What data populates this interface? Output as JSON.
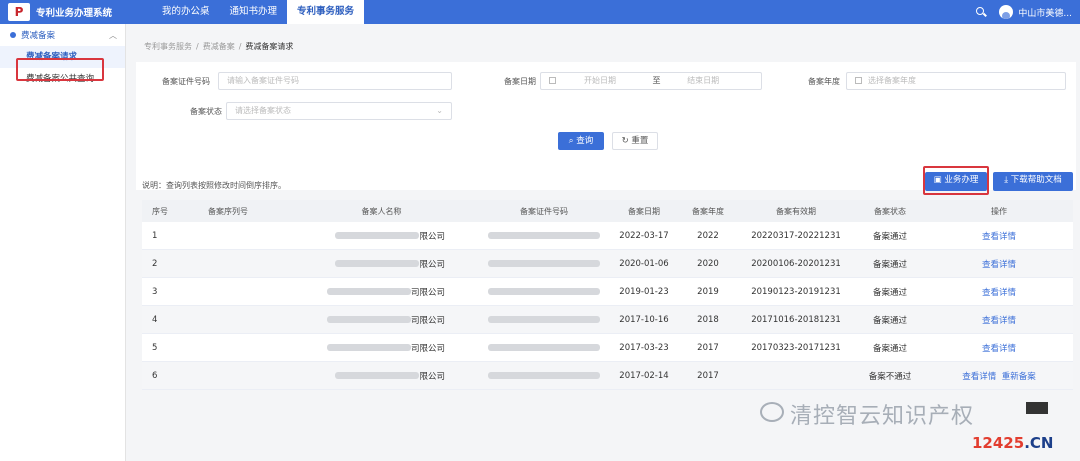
{
  "header": {
    "app_title": "专利业务办理系统",
    "tabs": [
      "我的办公桌",
      "通知书办理",
      "专利事务服务"
    ],
    "active_tab": 2,
    "user_name": "中山市美德..."
  },
  "sidebar": {
    "group": "费减备案",
    "items": [
      "费减备案请求",
      "费减备案公共查询"
    ],
    "active_item": 0
  },
  "breadcrumb": [
    "专利事务服务",
    "费减备案",
    "费减备案请求"
  ],
  "filters": {
    "id_number_label": "备案证件号码",
    "id_number_placeholder": "请输入备案证件号码",
    "date_label": "备案日期",
    "date_start_placeholder": "开始日期",
    "date_sep": "至",
    "date_end_placeholder": "结束日期",
    "year_label": "备案年度",
    "year_placeholder": "选择备案年度",
    "status_label": "备案状态",
    "status_placeholder": "请选择备案状态",
    "search_button": "查询",
    "reset_button": "重置"
  },
  "list": {
    "note": "说明：查询列表按照修改时间倒序排序。",
    "biz_button": "业务办理",
    "download_button": "下载帮助文档",
    "columns": [
      "序号",
      "备案序列号",
      "备案人名称",
      "备案证件号码",
      "备案日期",
      "备案年度",
      "备案有效期",
      "备案状态",
      "操作"
    ],
    "rows": [
      {
        "no": "1",
        "name_suffix": "限公司",
        "date": "2022-03-17",
        "year": "2022",
        "validity": "20220317-20221231",
        "status": "备案通过",
        "actions": [
          "查看详情"
        ]
      },
      {
        "no": "2",
        "name_suffix": "限公司",
        "date": "2020-01-06",
        "year": "2020",
        "validity": "20200106-20201231",
        "status": "备案通过",
        "actions": [
          "查看详情"
        ]
      },
      {
        "no": "3",
        "name_suffix": "司限公司",
        "date": "2019-01-23",
        "year": "2019",
        "validity": "20190123-20191231",
        "status": "备案通过",
        "actions": [
          "查看详情"
        ]
      },
      {
        "no": "4",
        "name_suffix": "司限公司",
        "date": "2017-10-16",
        "year": "2018",
        "validity": "20171016-20181231",
        "status": "备案通过",
        "actions": [
          "查看详情"
        ]
      },
      {
        "no": "5",
        "name_suffix": "司限公司",
        "date": "2017-03-23",
        "year": "2017",
        "validity": "20170323-20171231",
        "status": "备案通过",
        "actions": [
          "查看详情"
        ]
      },
      {
        "no": "6",
        "name_suffix": "限公司",
        "date": "2017-02-14",
        "year": "2017",
        "validity": "",
        "status": "备案不通过",
        "actions": [
          "查看详情",
          "重新备案"
        ]
      }
    ]
  },
  "watermark": {
    "text": "清控智云知识产权",
    "site_number": "12425",
    "site_domain": ".CN"
  }
}
